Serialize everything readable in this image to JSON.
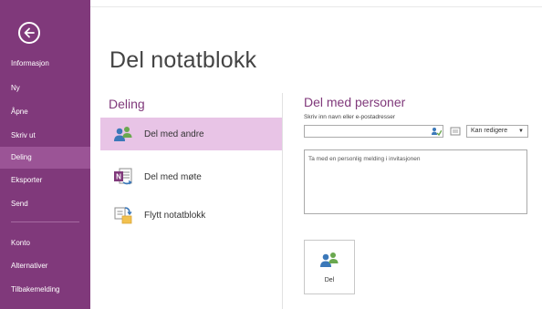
{
  "sidebar": {
    "items": [
      {
        "label": "Informasjon"
      },
      {
        "label": "Ny"
      },
      {
        "label": "Åpne"
      },
      {
        "label": "Skriv ut"
      },
      {
        "label": "Deling"
      },
      {
        "label": "Eksporter"
      },
      {
        "label": "Send"
      },
      {
        "label": "Konto"
      },
      {
        "label": "Alternativer"
      },
      {
        "label": "Tilbakemelding"
      }
    ],
    "active_item": "Deling"
  },
  "main": {
    "title": "Del notatblokk",
    "section_heading": "Deling",
    "options": [
      {
        "label": "Del med andre",
        "icon": "people-icon",
        "selected": true
      },
      {
        "label": "Del med møte",
        "icon": "onenote-meeting-icon",
        "selected": false
      },
      {
        "label": "Flytt notatblokk",
        "icon": "move-notebook-icon",
        "selected": false
      }
    ]
  },
  "share_panel": {
    "heading": "Del med personer",
    "name_field_label": "Skriv inn navn eller e-postadresser",
    "name_field_value": "",
    "permission_value": "Kan redigere",
    "message_placeholder": "Ta med en personlig melding i invitasjonen",
    "share_button_label": "Del"
  },
  "colors": {
    "sidebar_bg": "#80397b",
    "sidebar_active": "#9b5496",
    "accent": "#80397b",
    "selected_option_bg": "#e8c4e6"
  }
}
